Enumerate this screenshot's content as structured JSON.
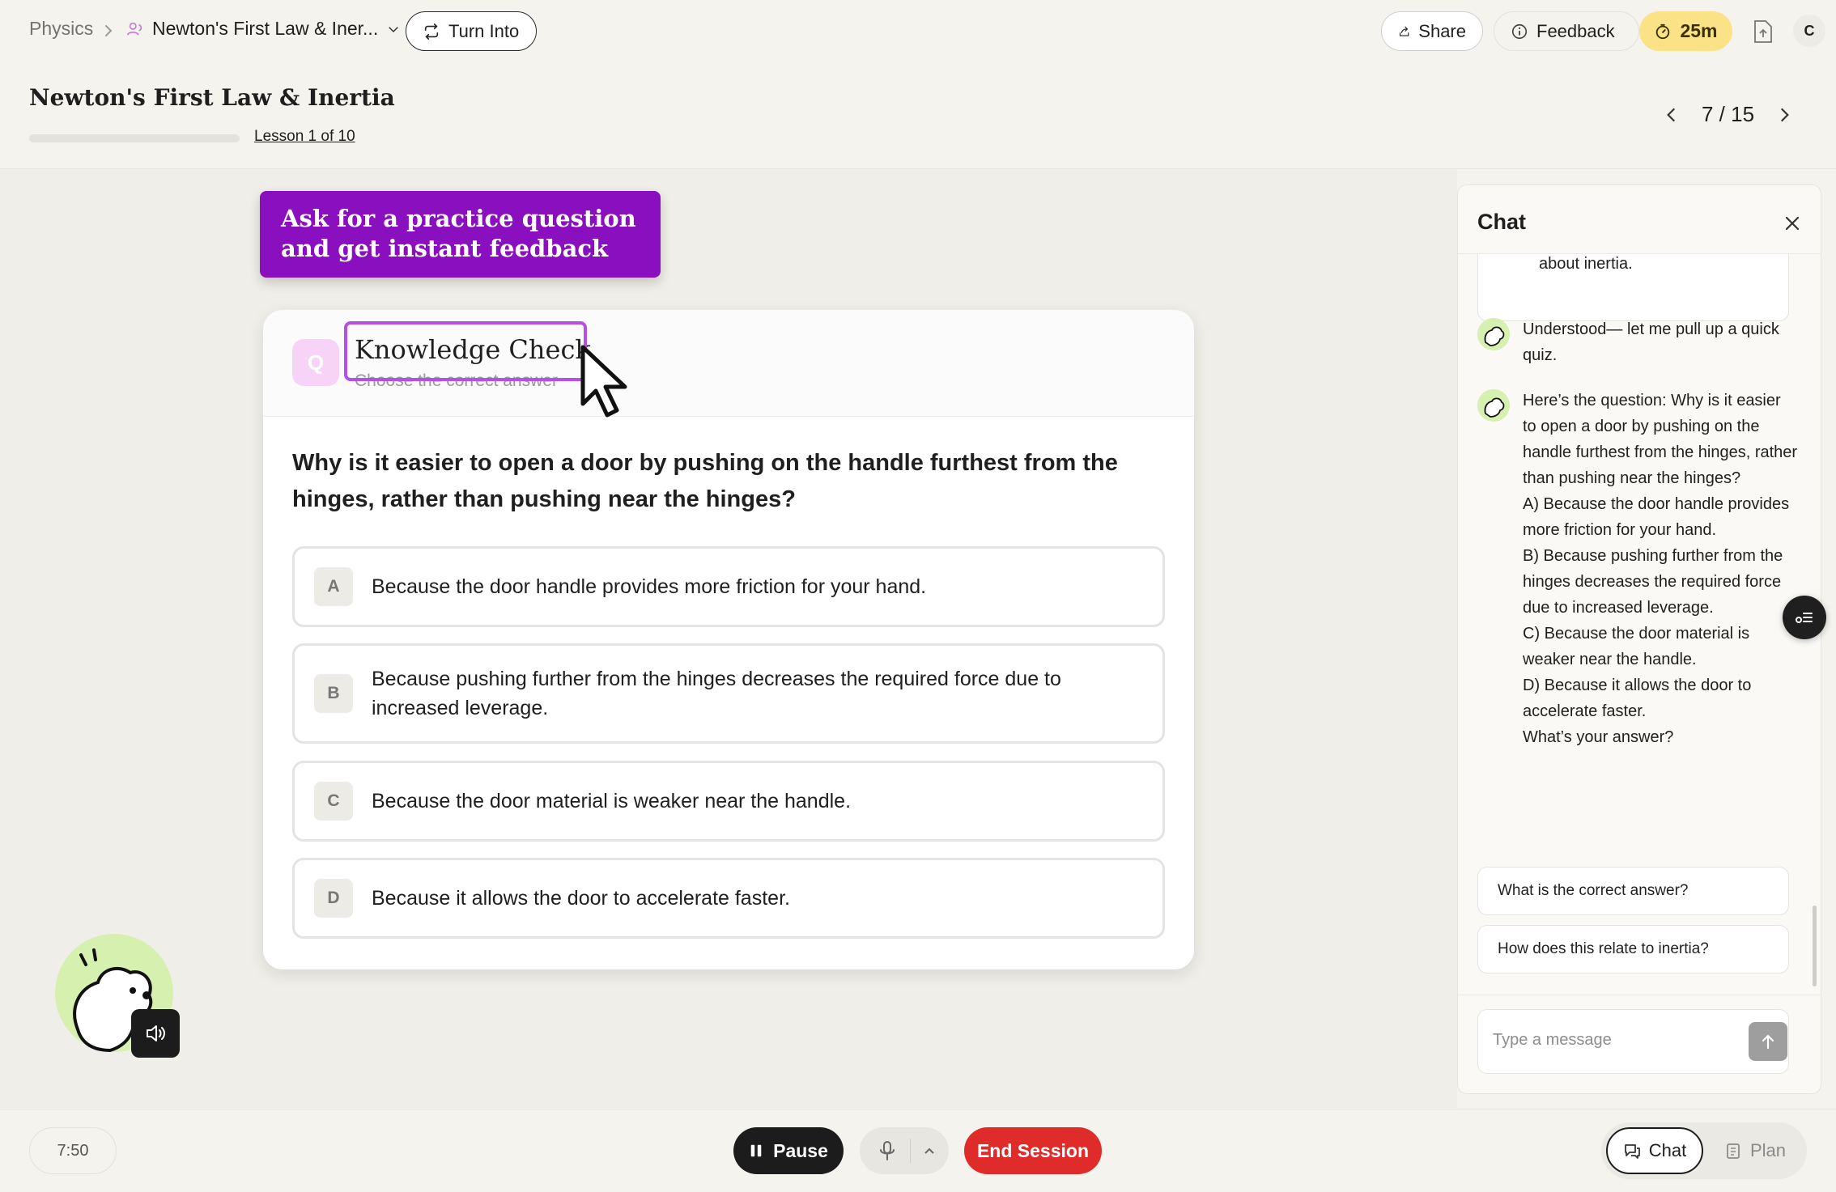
{
  "breadcrumb": {
    "subject": "Physics",
    "topic": "Newton's First Law & Iner..."
  },
  "toolbar": {
    "turn_into": "Turn Into",
    "share": "Share",
    "feedback": "Feedback",
    "timer": "25m",
    "avatar_initial": "C"
  },
  "lesson": {
    "title": "Newton's First Law & Inertia",
    "progress_fraction": 0.0,
    "count_label": "Lesson 1 of 10",
    "pager": "7 / 15"
  },
  "tooltip": {
    "text": "Ask for a practice question and get instant feedback"
  },
  "quiz": {
    "badge": "Q",
    "title": "Knowledge Check",
    "subtitle": "Choose the correct answer",
    "question": "Why is it easier to open a door by pushing on the handle furthest from the hinges, rather than pushing near the hinges?",
    "options": [
      {
        "letter": "A",
        "text": "Because the door handle provides more friction for your hand."
      },
      {
        "letter": "B",
        "text": "Because pushing further from the hinges decreases the required force due to increased leverage."
      },
      {
        "letter": "C",
        "text": "Because the door material is weaker near the handle."
      },
      {
        "letter": "D",
        "text": "Because it allows the door to accelerate faster."
      }
    ]
  },
  "chat": {
    "title": "Chat",
    "user_partial": "about inertia.",
    "messages": [
      "Understood— let me pull up a quick quiz.",
      "Here’s the question: Why is it easier to open a door by pushing on the handle furthest from the hinges, rather than pushing near the hinges?\nA) Because the door handle provides more friction for your hand.\nB) Because pushing further from the hinges decreases the required force due to increased leverage.\nC) Because the door material is weaker near the handle.\nD) Because it allows the door to accelerate faster.\nWhat’s your answer?"
    ],
    "suggestions": [
      "What is the correct answer?",
      "How does this relate to inertia?"
    ],
    "input_placeholder": "Type a message"
  },
  "bottom": {
    "elapsed": "7:50",
    "pause": "Pause",
    "end_session": "End Session",
    "chat_tab": "Chat",
    "plan_tab": "Plan"
  },
  "colors": {
    "accent_purple": "#8a0fbe",
    "highlight_purple": "#b74ee6",
    "timer_yellow": "#fbe287",
    "end_red": "#e02b2b",
    "mascot_green": "#d6f0b0"
  }
}
